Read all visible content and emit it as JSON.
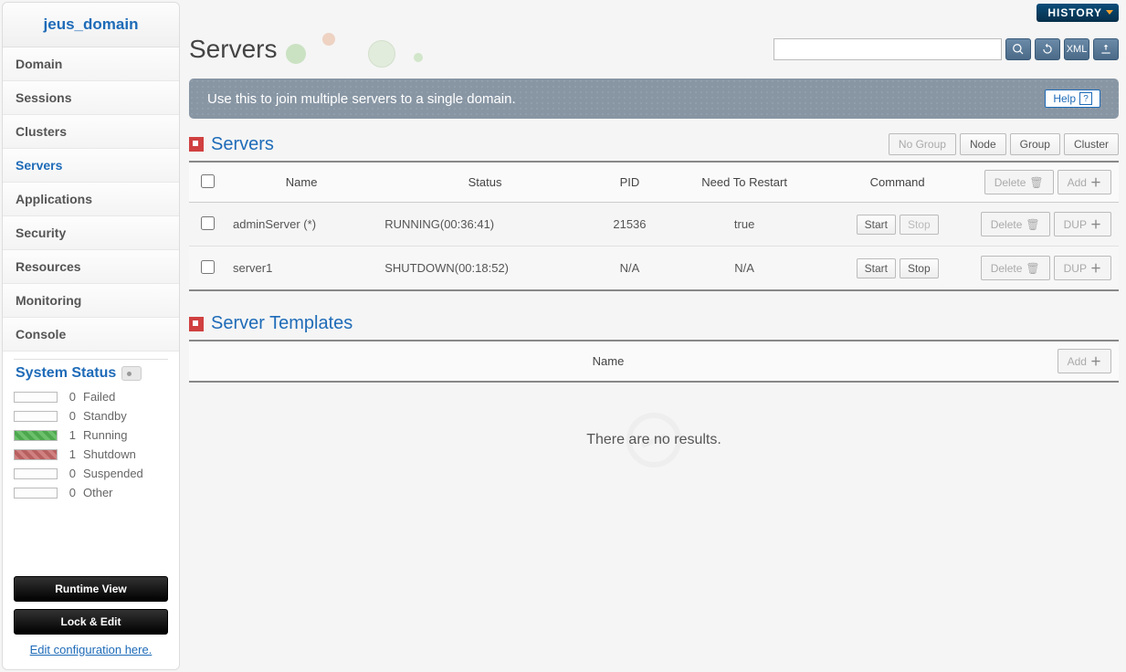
{
  "sidebar": {
    "domain_name": "jeus_domain",
    "nav": [
      {
        "label": "Domain",
        "active": false
      },
      {
        "label": "Sessions",
        "active": false
      },
      {
        "label": "Clusters",
        "active": false
      },
      {
        "label": "Servers",
        "active": true
      },
      {
        "label": "Applications",
        "active": false
      },
      {
        "label": "Security",
        "active": false
      },
      {
        "label": "Resources",
        "active": false
      },
      {
        "label": "Monitoring",
        "active": false
      },
      {
        "label": "Console",
        "active": false
      }
    ],
    "status": {
      "title": "System Status",
      "items": [
        {
          "count": "0",
          "label": "Failed",
          "cls": ""
        },
        {
          "count": "0",
          "label": "Standby",
          "cls": ""
        },
        {
          "count": "1",
          "label": "Running",
          "cls": "running"
        },
        {
          "count": "1",
          "label": "Shutdown",
          "cls": "shutdown"
        },
        {
          "count": "0",
          "label": "Suspended",
          "cls": ""
        },
        {
          "count": "0",
          "label": "Other",
          "cls": ""
        }
      ]
    },
    "actions": {
      "runtime_view": "Runtime View",
      "lock_edit": "Lock & Edit",
      "edit_config": "Edit configuration here."
    }
  },
  "topbar": {
    "history": "HISTORY"
  },
  "page": {
    "title": "Servers",
    "search_placeholder": ""
  },
  "infobar": {
    "text": "Use this to join multiple servers to a single domain.",
    "help": "Help"
  },
  "servers_section": {
    "title": "Servers",
    "view_buttons": {
      "no_group": "No Group",
      "node": "Node",
      "group": "Group",
      "cluster": "Cluster"
    },
    "columns": {
      "name": "Name",
      "status": "Status",
      "pid": "PID",
      "restart": "Need To Restart",
      "command": "Command"
    },
    "header_actions": {
      "delete": "Delete",
      "add": "Add"
    },
    "cmd_labels": {
      "start": "Start",
      "stop": "Stop"
    },
    "row_actions": {
      "delete": "Delete",
      "dup": "DUP"
    },
    "rows": [
      {
        "name": "adminServer (*)",
        "status": "RUNNING(00:36:41)",
        "pid": "21536",
        "restart": "true",
        "stop_disabled": true
      },
      {
        "name": "server1",
        "status": "SHUTDOWN(00:18:52)",
        "pid": "N/A",
        "restart": "N/A",
        "stop_disabled": false
      }
    ]
  },
  "templates_section": {
    "title": "Server Templates",
    "columns": {
      "name": "Name"
    },
    "add": "Add",
    "empty": "There are no results."
  }
}
